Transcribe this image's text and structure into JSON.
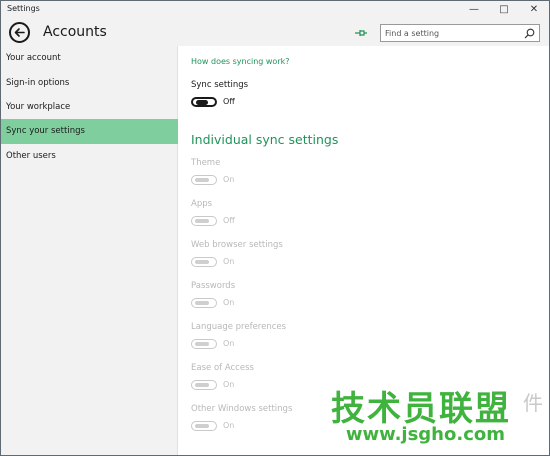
{
  "window": {
    "title": "Settings",
    "minimize": "—",
    "maximize": "□",
    "close": "✕"
  },
  "header": {
    "title": "Accounts",
    "search_placeholder": "Find a setting"
  },
  "sidebar": {
    "items": [
      {
        "label": "Your account",
        "selected": false
      },
      {
        "label": "Sign-in options",
        "selected": false
      },
      {
        "label": "Your workplace",
        "selected": false
      },
      {
        "label": "Sync your settings",
        "selected": true
      },
      {
        "label": "Other users",
        "selected": false
      }
    ]
  },
  "content": {
    "help_link": "How does syncing work?",
    "sync_settings": {
      "label": "Sync settings",
      "state": "Off"
    },
    "section_heading": "Individual sync settings",
    "individual": [
      {
        "label": "Theme",
        "state": "On"
      },
      {
        "label": "Apps",
        "state": "Off"
      },
      {
        "label": "Web browser settings",
        "state": "On"
      },
      {
        "label": "Passwords",
        "state": "On"
      },
      {
        "label": "Language preferences",
        "state": "On"
      },
      {
        "label": "Ease of Access",
        "state": "On"
      },
      {
        "label": "Other Windows settings",
        "state": "On"
      }
    ]
  },
  "watermark": {
    "main": "技术员联盟",
    "extra": "件",
    "url": "www.jsgho.com"
  },
  "colors": {
    "accent": "#21935a",
    "selected_nav": "#7fcf9e",
    "chrome": "#f2f2f2",
    "watermark": "#3fb33d"
  },
  "icons": {
    "back": "back-arrow-icon",
    "pin": "pin-icon",
    "search": "search-icon"
  }
}
